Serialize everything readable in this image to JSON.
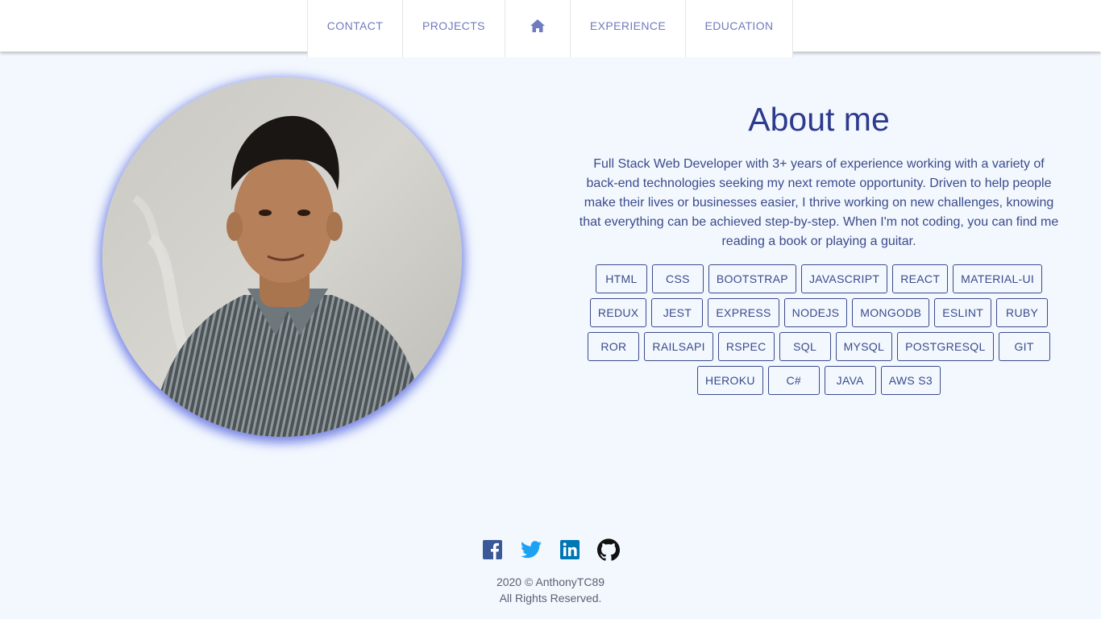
{
  "nav": {
    "contact": "CONTACT",
    "projects": "PROJECTS",
    "home_icon": "home-icon",
    "experience": "EXPERIENCE",
    "education": "EDUCATION"
  },
  "profile": {
    "photo": "profile-photo"
  },
  "about": {
    "title": "About me",
    "description": "Full Stack Web Developer with 3+ years of experience working with a variety of back-end technologies seeking my next remote opportunity. Driven to help people make their lives or businesses easier, I thrive working on new challenges, knowing that everything can be achieved step-by-step. When I'm not coding, you can find me reading a book or playing a guitar."
  },
  "skills": [
    "HTML",
    "CSS",
    "BOOTSTRAP",
    "JAVASCRIPT",
    "REACT",
    "MATERIAL-UI",
    "REDUX",
    "JEST",
    "EXPRESS",
    "NODEJS",
    "MONGODB",
    "ESLINT",
    "RUBY",
    "ROR",
    "RAILSAPI",
    "RSPEC",
    "SQL",
    "MYSQL",
    "POSTGRESQL",
    "GIT",
    "HEROKU",
    "C#",
    "JAVA",
    "AWS S3"
  ],
  "social": {
    "facebook": "facebook-icon",
    "twitter": "twitter-icon",
    "linkedin": "linkedin-icon",
    "github": "github-icon"
  },
  "footer": {
    "copyright": "2020 © AnthonyTC89",
    "rights": "All Rights Reserved."
  },
  "colors": {
    "background": "#f3f8fe",
    "accent": "#2d3a8e",
    "nav_text": "#6f7bbf",
    "facebook": "#3b5998",
    "twitter": "#1da1f2",
    "linkedin": "#0077b5",
    "github": "#111111"
  }
}
